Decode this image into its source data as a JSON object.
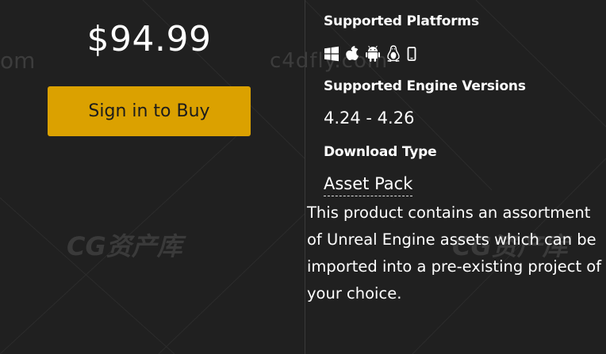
{
  "product": {
    "price": "$94.99",
    "buy_button_label": "Sign in to Buy"
  },
  "details": {
    "platforms_title": "Supported Platforms",
    "platform_icons": [
      "windows-icon",
      "apple-icon",
      "android-icon",
      "linux-icon",
      "mobile-icon"
    ],
    "engine_versions_title": "Supported Engine Versions",
    "engine_versions": "4.24 - 4.26",
    "download_type_title": "Download Type",
    "download_type": "Asset Pack",
    "description": "This product contains an assortment of Unreal Engine assets which can be imported into a pre-existing project of your choice."
  },
  "watermarks": {
    "site_top_left": "om",
    "site_top_right": "c4dfly.com",
    "brand_left": "CG资产库",
    "brand_right": "CG资产库"
  },
  "colors": {
    "background": "#202020",
    "accent_button": "#dba100",
    "button_text": "#1c1c1c",
    "text": "#ffffff",
    "divider": "#3a3a3a"
  }
}
